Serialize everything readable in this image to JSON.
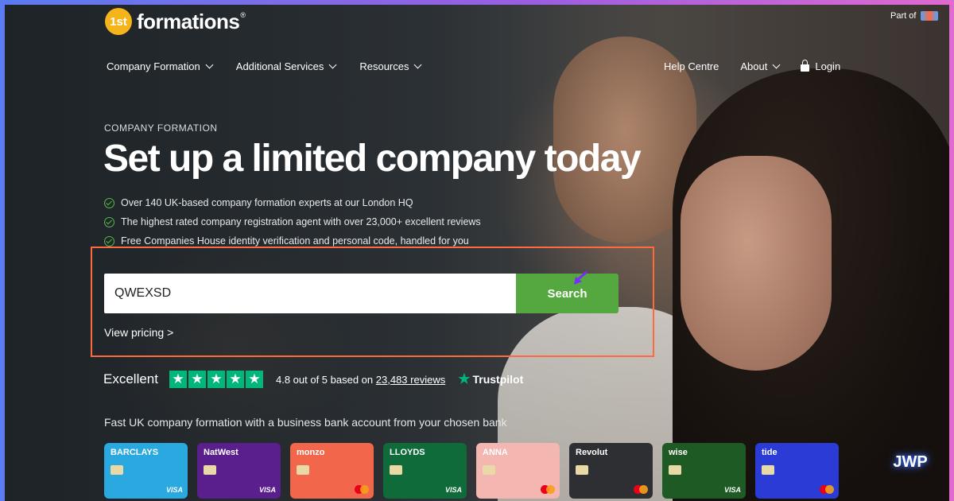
{
  "header": {
    "logo_badge": "1st",
    "logo_text": "formations",
    "logo_reg": "®",
    "part_of": "Part of"
  },
  "nav": {
    "left": [
      {
        "label": "Company Formation"
      },
      {
        "label": "Additional Services"
      },
      {
        "label": "Resources"
      }
    ],
    "help": "Help Centre",
    "about": "About",
    "login": "Login"
  },
  "hero": {
    "eyebrow": "COMPANY FORMATION",
    "title": "Set up a limited company today",
    "bullets": [
      "Over 140 UK-based company formation experts at our London HQ",
      "The highest rated company registration agent with over 23,000+ excellent reviews",
      "Free Companies House identity verification and personal code, handled for you"
    ]
  },
  "search": {
    "value": "QWEXSD",
    "button": "Search",
    "view_pricing": "View pricing >"
  },
  "rating": {
    "label": "Excellent",
    "stars": 5,
    "text_prefix": "4.8 out of 5 based on",
    "reviews_link": "23,483 reviews",
    "brand": "Trustpilot"
  },
  "banks": {
    "caption": "Fast UK company formation with a business bank account from your chosen bank",
    "cards": [
      {
        "name": "BARCLAYS",
        "color": "#2aa8e0",
        "network": "VISA"
      },
      {
        "name": "NatWest",
        "color": "#5a1f8c",
        "network": "VISA"
      },
      {
        "name": "monzo",
        "color": "#f2674c",
        "network": "mastercard"
      },
      {
        "name": "LLOYDS",
        "color": "#0f6b3a",
        "network": "VISA"
      },
      {
        "name": "ANNA",
        "color": "#f4b6b0",
        "network": "mastercard"
      },
      {
        "name": "Revolut",
        "color": "#2d2f33",
        "network": "mastercard"
      },
      {
        "name": "wise",
        "color": "#1e5a23",
        "network": "VISA"
      },
      {
        "name": "tide",
        "color": "#2a3bd6",
        "network": "mastercard"
      }
    ]
  },
  "watermark": "JWP",
  "colors": {
    "accent_green": "#55a83f",
    "highlight_orange": "#ff6a3d",
    "trustpilot_green": "#00b67a",
    "logo_yellow": "#f4b41a"
  }
}
